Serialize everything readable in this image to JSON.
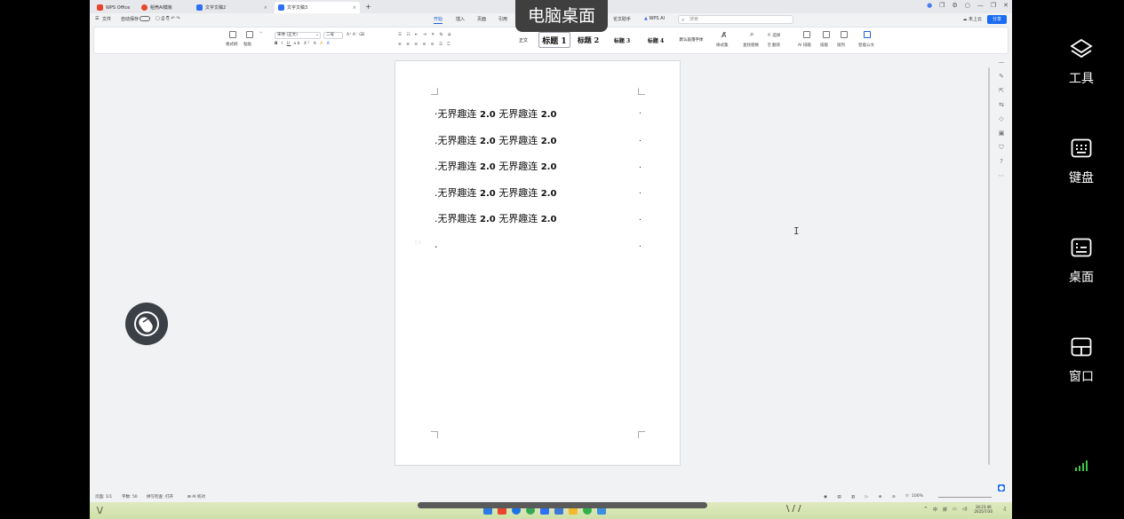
{
  "app": {
    "tabs": [
      {
        "label": "WPS Office",
        "color": "#e8452c"
      },
      {
        "label": "稻壳AI模板",
        "color": "#e8452c"
      },
      {
        "label": "文字文稿2",
        "color": "#2d6ff5"
      },
      {
        "label": "文字文稿3",
        "color": "#2d6ff5"
      }
    ],
    "new_tab": "+",
    "window_controls": [
      "—",
      "❐",
      "✕"
    ]
  },
  "menu": {
    "file": "文件",
    "autosave": "自动保存",
    "items": [
      "开始",
      "插入",
      "页面",
      "引用",
      "论文助手",
      "WPS AI"
    ],
    "search_placeholder": "搜索",
    "cloud": "未上云",
    "share": "分享"
  },
  "ribbon": {
    "format_painter": "格式刷",
    "paste": "粘贴",
    "font_name": "宋体 (正文)",
    "font_size": "二号",
    "styles": [
      "正文",
      "标题 1",
      "标题 2",
      "标题 3",
      "标题 4",
      "默认段落字体"
    ],
    "style_set": "样式集",
    "find_replace": "查找替换",
    "select": "选择",
    "translate": "翻译",
    "ai_layout": "AI 排版",
    "layout": "排版",
    "arrange": "排列",
    "smart_doc": "智能公文"
  },
  "document": {
    "lines": [
      {
        "text": "无界趣连",
        "num": "2.0",
        "text2": "无界趣连",
        "num2": "2.0"
      },
      {
        "text": "无界趣连",
        "num": "2.0",
        "text2": "无界趣连",
        "num2": "2.0"
      },
      {
        "text": "无界趣连",
        "num": "2.0",
        "text2": "无界趣连",
        "num2": "2.0"
      },
      {
        "text": "无界趣连",
        "num": "2.0",
        "text2": "无界趣连",
        "num2": "2.0"
      },
      {
        "text": "无界趣连",
        "num": "2.0",
        "text2": "无界趣连",
        "num2": "2.0"
      }
    ],
    "paragraph_mark": "."
  },
  "statusbar": {
    "page": "页面: 1/1",
    "words": "字数: 50",
    "spellcheck": "拼写检查: 打开",
    "ai_check": "AI 校对",
    "zoom": "100%"
  },
  "taskbar": {
    "time": "18:23:46",
    "date": "2025/7/30",
    "tray_lang": "中",
    "tray_ime": "拼"
  },
  "overlay": {
    "desktop_title": "电脑桌面"
  },
  "right_panel": {
    "items": [
      {
        "label": "工具",
        "icon": "layers-icon"
      },
      {
        "label": "键盘",
        "icon": "keyboard-icon"
      },
      {
        "label": "桌面",
        "icon": "desktop-icon"
      },
      {
        "label": "窗口",
        "icon": "window-grid-icon"
      }
    ],
    "signal_color": "#3cc94a"
  }
}
